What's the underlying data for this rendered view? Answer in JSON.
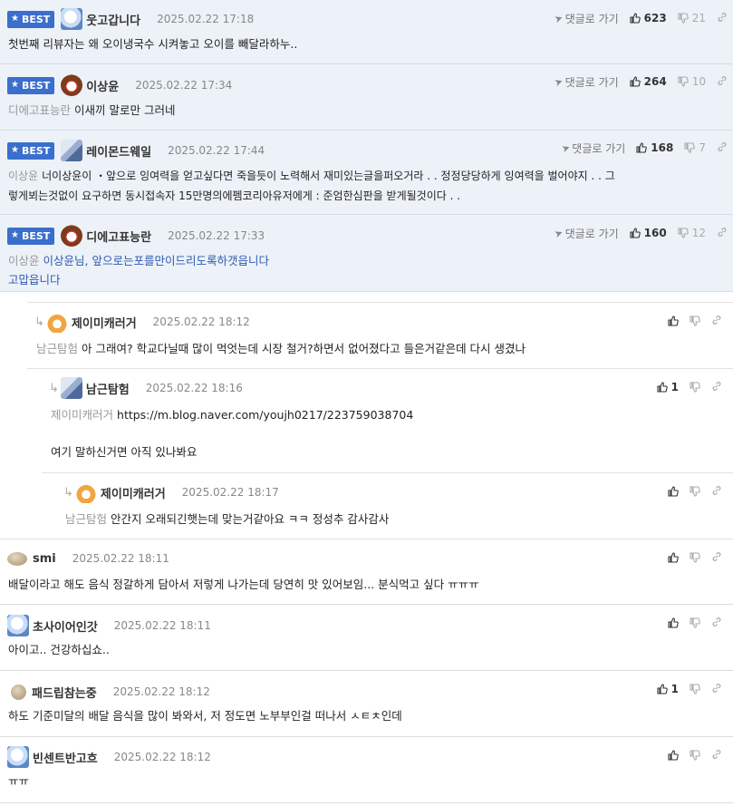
{
  "best_label": "BEST",
  "goto_label": "댓글로 가기",
  "comments": [
    {
      "nick": "웃고갑니다",
      "date": "2025.02.22 17:18",
      "up": "623",
      "down": "21",
      "mention": "",
      "text": "첫번째 리뷰자는 왜 오이냉국수 시켜놓고 오이를 빼달라하누.."
    },
    {
      "nick": "이상윤",
      "date": "2025.02.22 17:34",
      "up": "264",
      "down": "10",
      "mention": "디에고표능란",
      "text": "이새끼 말로만 그러네"
    },
    {
      "nick": "레이몬드웨일",
      "date": "2025.02.22 17:44",
      "up": "168",
      "down": "7",
      "mention": "이상윤",
      "text": "너이상윤이 ・앞으로 잉여력을 얻고싶다면 죽을듯이 노력해서 재미있는글을퍼오거라 . . 정정당당하게 잉여력을 벌어야지 . . 그",
      "text2": "렇게뵈는것없이 요구하면 동시접속자 15만명의에펨코리아유저에게 : 준엄한심판을 받게될것이다 . ."
    },
    {
      "nick": "디에고표능란",
      "date": "2025.02.22 17:33",
      "up": "160",
      "down": "12",
      "mention": "이상윤",
      "text": "이상윤님, 앞으로는포를만이드리도록하갯읍니다",
      "text2": "고맙읍니다"
    },
    {
      "nick": "제이미캐러거",
      "date": "2025.02.22 18:12",
      "up": "",
      "mention": "남근탐험",
      "text": "아 그래여? 학교다닐때 많이 먹엇는데 시장 철거?하면서 없어졌다고 들은거같은데 다시 생겼나"
    },
    {
      "nick": "남근탐험",
      "date": "2025.02.22 18:16",
      "up": "1",
      "mention": "제이미캐러거",
      "text": "https://m.blog.naver.com/youjh0217/223759038704",
      "text2": "여기 말하신거면 아직 있나봐요"
    },
    {
      "nick": "제이미캐러거",
      "date": "2025.02.22 18:17",
      "up": "",
      "mention": "남근탐험",
      "text": "안간지 오래되긴햇는데 맞는거같아요 ㅋㅋ 정성추 감사감사"
    },
    {
      "nick": "smi",
      "date": "2025.02.22 18:11",
      "up": "",
      "mention": "",
      "text": "배달이라고 해도 음식 정갈하게 담아서 저렇게 나가는데 당연히 맛 있어보임... 분식먹고 싶다 ㅠㅠㅠ"
    },
    {
      "nick": "초사이어인갓",
      "date": "2025.02.22 18:11",
      "up": "",
      "mention": "",
      "text": "아이고.. 건강하십쇼.."
    },
    {
      "nick": "패드립참는중",
      "date": "2025.02.22 18:12",
      "up": "1",
      "mention": "",
      "text": "하도 기준미달의 배달 음식을 많이 봐와서, 저 정도면 노부부인걸 떠나서 ㅅㅌㅊ인데"
    },
    {
      "nick": "빈센트반고흐",
      "date": "2025.02.22 18:12",
      "up": "",
      "mention": "",
      "text": "ㅠㅠ"
    }
  ]
}
